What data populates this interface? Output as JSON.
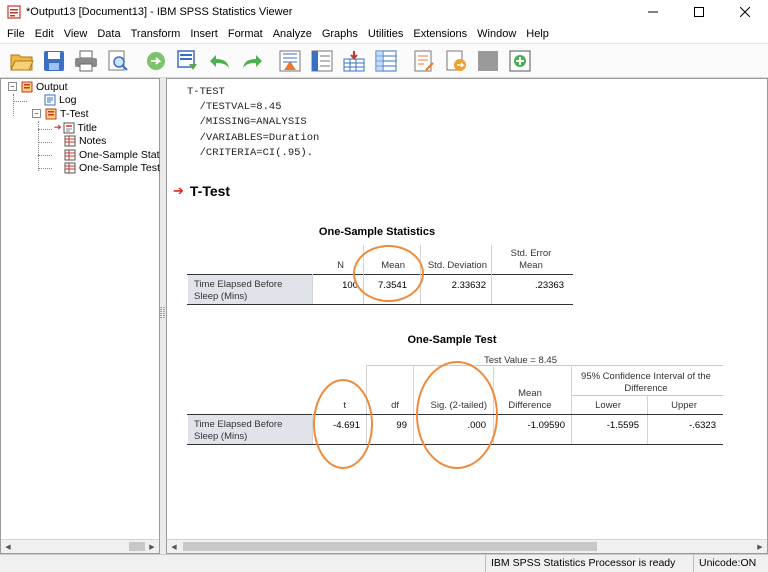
{
  "window": {
    "title": "*Output13 [Document13] - IBM SPSS Statistics Viewer"
  },
  "menu": {
    "items": [
      "File",
      "Edit",
      "View",
      "Data",
      "Transform",
      "Insert",
      "Format",
      "Analyze",
      "Graphs",
      "Utilities",
      "Extensions",
      "Window",
      "Help"
    ]
  },
  "toolbar": {
    "icons": [
      "open-icon",
      "save-icon",
      "print-icon",
      "print-preview-icon",
      "export-icon",
      "recall-dialog-icon",
      "undo-icon",
      "redo-icon",
      "goto-data-icon",
      "goto-case-icon",
      "insert-variable-icon",
      "variables-icon",
      "designate-window-icon",
      "select-last-output-icon",
      "show-all-icon",
      "promote-icon"
    ]
  },
  "tree": {
    "items": [
      "Output",
      "Log",
      "T-Test",
      "Title",
      "Notes",
      "One-Sample Stati",
      "One-Sample Test"
    ]
  },
  "syntax": {
    "lines": [
      "T-TEST",
      "  /TESTVAL=8.45",
      "  /MISSING=ANALYSIS",
      "  /VARIABLES=Duration",
      "  /CRITERIA=CI(.95)."
    ]
  },
  "section": {
    "title": "T-Test"
  },
  "stats_table": {
    "title": "One-Sample Statistics",
    "headers": {
      "n": "N",
      "mean": "Mean",
      "std_dev": "Std. Deviation",
      "std_err_1": "Std. Error",
      "std_err_2": "Mean"
    },
    "row": {
      "label_1": "Time Elapsed Before",
      "label_2": "Sleep (Mins)",
      "n": "100",
      "mean": "7.3541",
      "std_dev": "2.33632",
      "std_err": ".23363"
    }
  },
  "test_table": {
    "title": "One-Sample Test",
    "test_value": "Test Value = 8.45",
    "headers": {
      "ci_1": "95% Confidence Interval of the",
      "ci_2": "Difference",
      "t": "t",
      "df": "df",
      "sig": "Sig. (2-tailed)",
      "mean_diff_1": "Mean",
      "mean_diff_2": "Difference",
      "lower": "Lower",
      "upper": "Upper"
    },
    "row": {
      "label_1": "Time Elapsed Before",
      "label_2": "Sleep (Mins)",
      "t": "-4.691",
      "df": "99",
      "sig": ".000",
      "mean_diff": "-1.09590",
      "lower": "-1.5595",
      "upper": "-.6323"
    }
  },
  "status": {
    "processor": "IBM SPSS Statistics Processor is ready",
    "unicode": "Unicode:ON"
  },
  "colors": {
    "highlight_ellipse": "#ef8a3a",
    "row_label_bg": "#e0e4ea",
    "section_arrow": "#e3221b"
  }
}
